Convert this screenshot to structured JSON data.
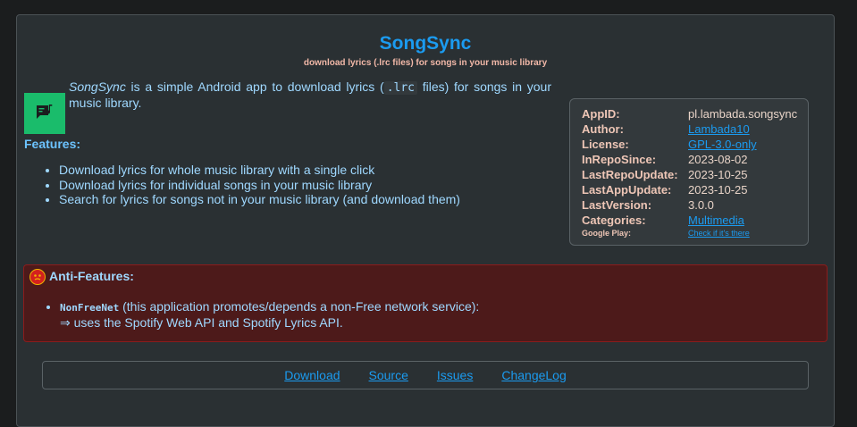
{
  "app": {
    "title": "SongSync",
    "subtitle": "download lyrics (.lrc files) for songs in your music library"
  },
  "description": {
    "name": "SongSync",
    "part1": " is a simple Android app to download lyrics (",
    "code": ".lrc",
    "part2": " files) for songs in your music library."
  },
  "features": {
    "heading": "Features:",
    "items": [
      "Download lyrics for whole music library with a single click",
      "Download lyrics for individual songs in your music library",
      "Search for lyrics for songs not in your music library (and download them)"
    ]
  },
  "info": {
    "rows": [
      {
        "key": "AppID:",
        "value": "pl.lambada.songsync",
        "link": false
      },
      {
        "key": "Author:",
        "value": "Lambada10",
        "link": true
      },
      {
        "key": "License:",
        "value": "GPL-3.0-only",
        "link": true
      },
      {
        "key": "InRepoSince:",
        "value": "2023-08-02",
        "link": false
      },
      {
        "key": "LastRepoUpdate:",
        "value": "2023-10-25",
        "link": false
      },
      {
        "key": "LastAppUpdate:",
        "value": "2023-10-25",
        "link": false
      },
      {
        "key": "LastVersion:",
        "value": "3.0.0",
        "link": false
      },
      {
        "key": "Categories:",
        "value": "Multimedia",
        "link": true
      },
      {
        "key": "Google Play:",
        "value": "Check if it's there",
        "link": true
      }
    ]
  },
  "anti_features": {
    "heading": "Anti-Features:",
    "item_code": "NonFreeNet",
    "item_text": " (this application promotes/depends a non-Free network service):",
    "item_detail": "⇒ uses the Spotify Web API and Spotify Lyrics API."
  },
  "links": [
    "Download",
    "Source",
    "Issues",
    "ChangeLog"
  ]
}
